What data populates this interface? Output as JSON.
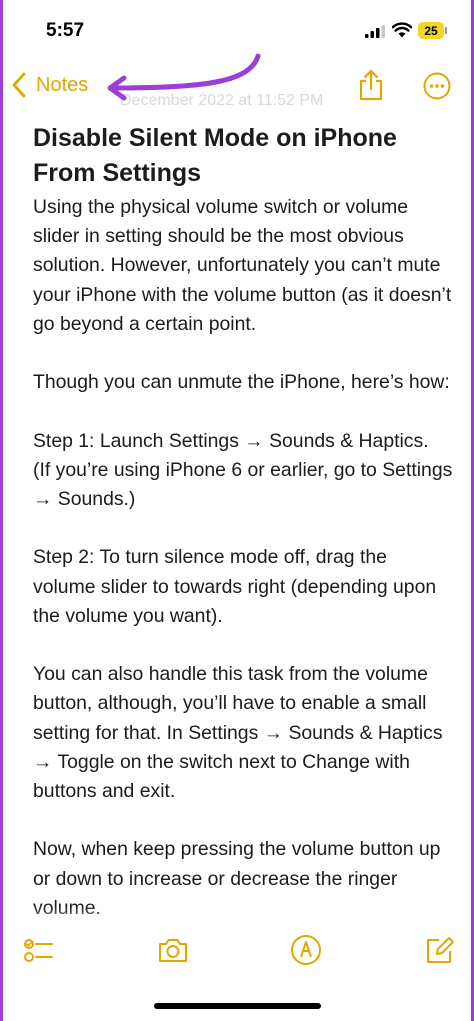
{
  "status": {
    "time": "5:57",
    "battery": "25"
  },
  "nav": {
    "back_label": "Notes",
    "faded_date": "December 2022 at 11:52 PM"
  },
  "note": {
    "title": "Disable Silent Mode on iPhone From Settings",
    "paragraphs": [
      "Using the physical volume switch or volume slider in setting should be the most obvious solution. However, unfortunately you can’t mute your iPhone with the volume button (as it doesn’t go beyond a certain point.",
      "Though you can unmute the iPhone, here’s how:",
      "Step 1: Launch Settings → Sounds & Haptics.\n(If you’re using iPhone 6 or earlier, go to Settings → Sounds.)",
      "Step 2: To turn silence mode off, drag the volume slider to towards right (depending upon the volume you want).",
      "You can also handle this task from the volume button, although, you’ll have to enable a small setting for that. In Settings → Sounds & Haptics → Toggle on the switch next to Change with buttons and exit.",
      "Now, when keep pressing the volume button up or down to increase or decrease the ringer volume."
    ]
  },
  "colors": {
    "accent": "#e0a800",
    "annotation": "#9b3fd6",
    "battery": "#f5d524"
  },
  "icons": {
    "back": "chevron-left-icon",
    "share": "share-icon",
    "more": "more-icon",
    "checklist": "checklist-icon",
    "camera": "camera-icon",
    "markup": "markup-pen-icon",
    "compose": "compose-icon"
  }
}
